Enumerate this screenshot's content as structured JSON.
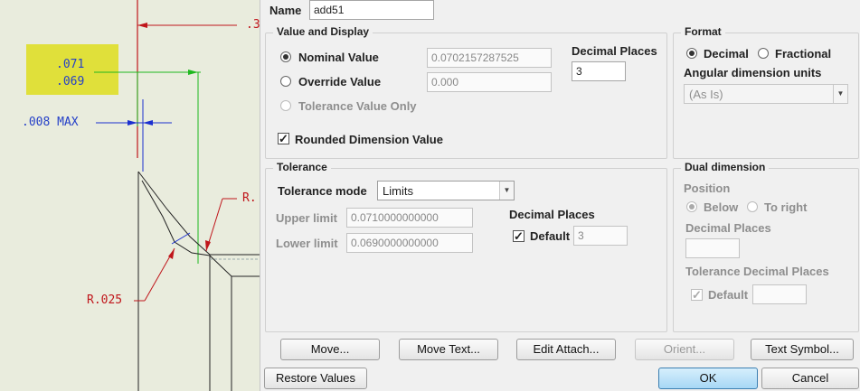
{
  "drawing": {
    "tolerance_upper": ".071",
    "tolerance_lower": ".069",
    "max_note": ".008 MAX",
    "radius_label": "R.025",
    "radius_label_partial": "R.",
    "top_partial": ".3",
    "highlight_color": "#e0e03a"
  },
  "name": {
    "label": "Name",
    "value": "add51"
  },
  "value_display": {
    "title": "Value and Display",
    "nominal_label": "Nominal Value",
    "nominal_value": "0.0702157287525",
    "override_label": "Override Value",
    "override_value": "0.000",
    "tolerance_only_label": "Tolerance Value Only",
    "decimal_places_label": "Decimal Places",
    "decimal_places_value": "3",
    "rounded_label": "Rounded Dimension Value"
  },
  "format": {
    "title": "Format",
    "decimal_label": "Decimal",
    "fractional_label": "Fractional",
    "angular_label": "Angular dimension units",
    "angular_value": "(As Is)"
  },
  "tolerance": {
    "title": "Tolerance",
    "mode_label": "Tolerance mode",
    "mode_value": "Limits",
    "upper_label": "Upper limit",
    "upper_value": "0.0710000000000",
    "lower_label": "Lower limit",
    "lower_value": "0.0690000000000",
    "decimal_places_label": "Decimal Places",
    "default_label": "Default",
    "default_value": "3"
  },
  "dual": {
    "title": "Dual dimension",
    "position_label": "Position",
    "below_label": "Below",
    "right_label": "To right",
    "decimal_places_label": "Decimal Places",
    "tol_decimal_label": "Tolerance Decimal Places",
    "default_label": "Default"
  },
  "buttons": {
    "move": "Move...",
    "move_text": "Move Text...",
    "edit_attach": "Edit Attach...",
    "orient": "Orient...",
    "text_symbol": "Text Symbol...",
    "restore": "Restore Values",
    "ok": "OK",
    "cancel": "Cancel"
  }
}
